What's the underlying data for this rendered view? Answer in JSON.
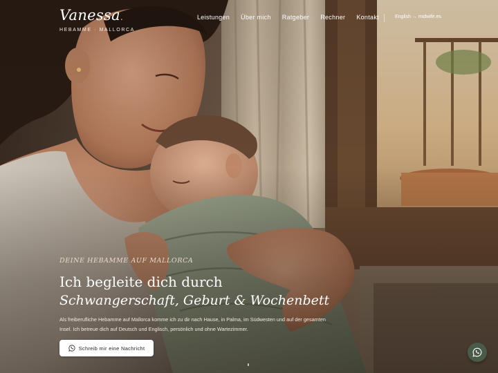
{
  "brand": {
    "name": "Vanessa",
    "tagline": "HEBAMME · MALLORCA"
  },
  "nav": {
    "items": [
      {
        "label": "Leistungen"
      },
      {
        "label": "Über mich"
      },
      {
        "label": "Ratgeber"
      },
      {
        "label": "Rechner"
      },
      {
        "label": "Kontakt"
      }
    ],
    "lang_link": "English → midwife.es"
  },
  "hero": {
    "eyebrow": "Deine Hebamme auf Mallorca",
    "headline_line1": "Ich begleite dich durch",
    "headline_line2": "Schwangerschaft, Geburt & Wochenbett",
    "lead": "Als freiberufliche Hebamme auf Mallorca komme ich zu dir nach Hause, in Palma, im Südwesten und auf der gesamten Insel. Ich betreue dich auf Deutsch und Englisch, persönlich und ohne Wartezimmer.",
    "cta_label": "Schreib mir eine Nachricht",
    "photo_icon": "mother-holding-newborn-photo"
  },
  "icons": {
    "cta": "whatsapp-icon",
    "floating": "whatsapp-icon"
  },
  "colors": {
    "floating_button": "#4a5a49",
    "accent": "#f4c9a6",
    "cta_bg": "#ffffff"
  }
}
